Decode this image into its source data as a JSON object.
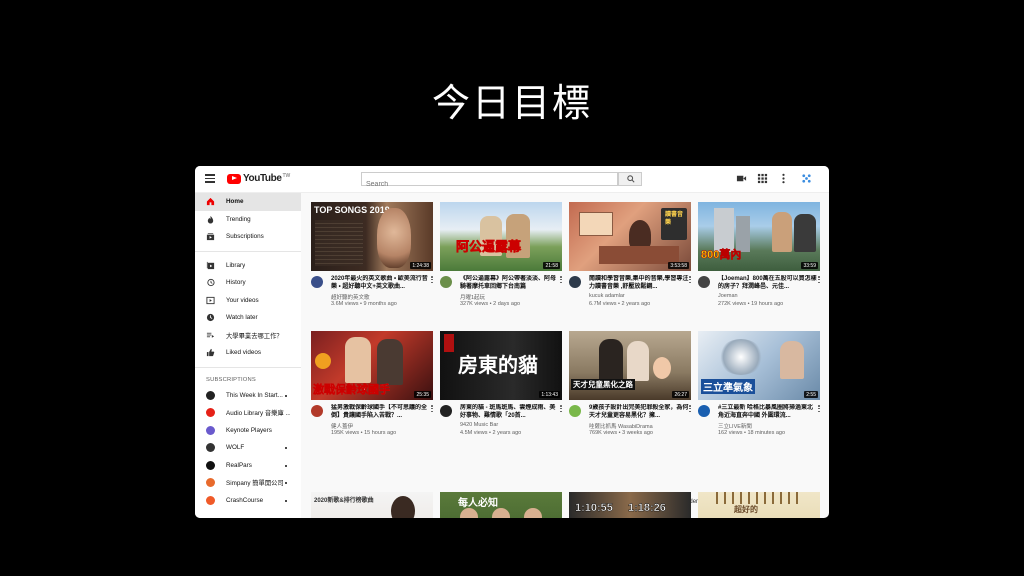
{
  "slide": {
    "title": "今日目標"
  },
  "header": {
    "logo_text": "YouTube",
    "logo_region": "TW",
    "search_placeholder": "Search"
  },
  "sidebar": {
    "main": [
      {
        "label": "Home",
        "icon": "home-icon",
        "active": true
      },
      {
        "label": "Trending",
        "icon": "flame-icon"
      },
      {
        "label": "Subscriptions",
        "icon": "subscriptions-icon"
      }
    ],
    "library": [
      {
        "label": "Library",
        "icon": "library-icon"
      },
      {
        "label": "History",
        "icon": "history-icon"
      },
      {
        "label": "Your videos",
        "icon": "your-videos-icon"
      },
      {
        "label": "Watch later",
        "icon": "clock-icon"
      },
      {
        "label": "大學畢業去哪工作？",
        "icon": "playlist-icon"
      },
      {
        "label": "Liked videos",
        "icon": "thumbs-up-icon"
      }
    ],
    "subscriptions_heading": "SUBSCRIPTIONS",
    "subscriptions": [
      {
        "label": "This Week In Start...",
        "color": "#222222"
      },
      {
        "label": "Audio Library 音樂庫 ...",
        "color": "#e62117"
      },
      {
        "label": "Keynote Players",
        "color": "#6a5acd"
      },
      {
        "label": "WOLF",
        "color": "#333333"
      },
      {
        "label": "RealPars",
        "color": "#111111"
      },
      {
        "label": "Simpany 簡單開公司",
        "color": "#e86a2c"
      },
      {
        "label": "CrashCourse",
        "color": "#f05a28"
      }
    ]
  },
  "videos": [
    {
      "title": "2020年最火的英文歌曲 • 歐美流行音樂 • 超好聽中文+英文歌曲...",
      "channel": "超好聽的英文歌",
      "meta": "3.6M views • 9 months ago",
      "duration": "1:24:38",
      "thumb_text": "TOP SONGS 2019"
    },
    {
      "title": "《阿公逼露幕》阿公帶著淡淡、阿母騎著摩托車回鄉下台南篇",
      "channel": "月曜1起玩",
      "meta": "327K views • 2 days ago",
      "duration": "21:58",
      "thumb_text": "阿公逼露幕"
    },
    {
      "title": "閱讀和學習音樂,集中的音樂,學習專注力讀書音樂 ,舒壓放鬆鋼...",
      "channel": "kucuk adamlar",
      "meta": "6.7M views • 2 years ago",
      "duration": "3:53:58",
      "thumb_text": "讀書音樂"
    },
    {
      "title": "【Joeman】800萬在五股可以買怎樣的房子？拜潤峰邑、元佳...",
      "channel": "Joeman",
      "meta": "272K views • 19 hours ago",
      "duration": "33:59",
      "thumb_text": "800萬內"
    },
    {
      "title": "猛男激戰保齡球國手【不可思議的全倒】貴讓國手陷入苦戰？...",
      "channel": "健人蓋伊",
      "meta": "195K views • 15 hours ago",
      "duration": "25:35",
      "thumb_text": "激戰保齡球國手"
    },
    {
      "title": "房東的貓 - 斑馬斑馬、雲煙成雨、美好事物、難情歌「20首...",
      "channel": "9420 Music Bar",
      "meta": "4.5M views • 2 years ago",
      "duration": "1:13:43",
      "thumb_text": "房東的貓"
    },
    {
      "title": "9歲孩子設計出完美犯罪殺全家，為何天才兒童更容易黑化？擁...",
      "channel": "哇薩比抓馬 WasabiDrama",
      "meta": "769K views • 3 weeks ago",
      "duration": "26:27",
      "thumb_text": "天才兒童黑化之路"
    },
    {
      "title": "#三立最新 哈格比暴風圈將掃過東北角近海直奔中國 外圍環流...",
      "channel": "三立LIVE新聞",
      "meta": "162 views • 18 minutes ago",
      "duration": "2:55",
      "thumb_text": "三立準氣象"
    },
    {
      "title": "",
      "channel": "",
      "meta": "",
      "duration": "",
      "thumb_text": "2020新歌&排行榜歌曲"
    },
    {
      "title": "",
      "channel": "",
      "meta": "",
      "duration": "",
      "thumb_text": "每人必知"
    },
    {
      "title": "",
      "channel": "",
      "meta": "",
      "duration": "",
      "thumb_text": "1:10:55 1:18:26"
    },
    {
      "title": "",
      "channel": "",
      "meta": "",
      "duration": "",
      "thumb_text": "超好的"
    }
  ],
  "option_hidden": "Option hidden.",
  "colors": {
    "accent": "#ff0000"
  }
}
